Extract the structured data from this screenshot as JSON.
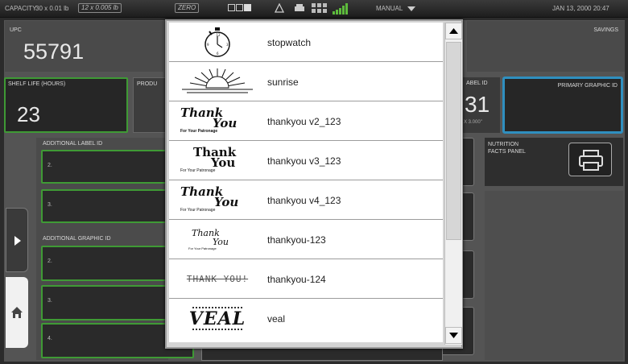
{
  "topbar": {
    "capacity_label": "CAPACITY",
    "capacity_value": "30 x 0.01 lb",
    "increment_value": "12 x 0.005 lb",
    "zero_label": "ZERO",
    "mode_label": "MANUAL",
    "datetime": "JAN 13, 2000 20:47"
  },
  "fields": {
    "upc_label": "UPC",
    "upc_value": "55791",
    "savings_label": "SAVINGS",
    "shelf_life_label": "SHELF LIFE (HOURS)",
    "shelf_life_value": "23",
    "product_label": "PRODU",
    "label_id_label": "ABEL ID",
    "label_id_value": "31",
    "label_size": "x 3.000\"",
    "primary_graphic_label": "PRIMARY GRAPHIC ID",
    "additional_label_label": "ADDITIONAL LABEL ID",
    "additional_label_fields": [
      "2.",
      "3."
    ],
    "additional_graphic_label": "ADDITIONAL GRAPHIC ID",
    "additional_graphic_fields": [
      "2.",
      "3.",
      "4."
    ],
    "nutrition_label": "NUTRITION FACTS PANEL"
  },
  "graphics_list": {
    "items": [
      {
        "name": "stopwatch",
        "thumb": "stopwatch"
      },
      {
        "name": "sunrise",
        "thumb": "sunrise"
      },
      {
        "name": "thankyou v2_123",
        "thumb_big1": "Thank",
        "thumb_big2": "You",
        "thumb_small": "For Your Patronage"
      },
      {
        "name": "thankyou v3_123",
        "thumb_big1": "Thank",
        "thumb_big2": "You",
        "thumb_small": "For Your Patronage"
      },
      {
        "name": "thankyou v4_123",
        "thumb_big1": "Thank",
        "thumb_big2": "You",
        "thumb_small": "For Your Patronage"
      },
      {
        "name": "thankyou-123",
        "thumb_big1": "Thank",
        "thumb_big2": "You",
        "thumb_small": "For Your Patronage"
      },
      {
        "name": "thankyou-124",
        "thumb_big1": "THANK YOU!"
      },
      {
        "name": "veal",
        "thumb_big1": "VEAL"
      }
    ]
  },
  "colors": {
    "accent_green": "#3f9a35",
    "accent_blue": "#2f8fbf"
  }
}
